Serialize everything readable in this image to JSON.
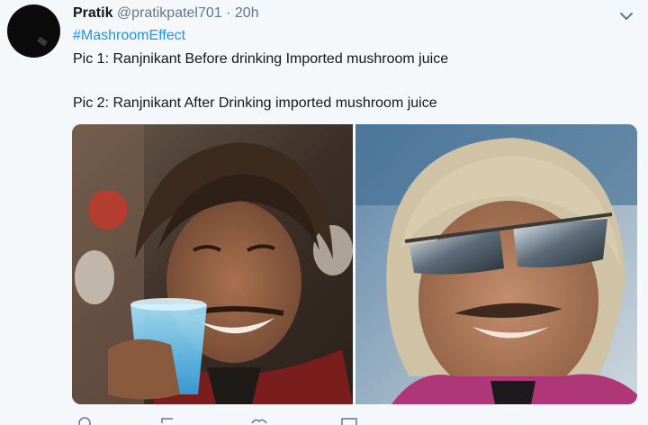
{
  "tweet": {
    "author_name": "Pratik",
    "author_handle": "@pratikpatel701",
    "separator": " · ",
    "time": "20h",
    "hashtag": "#MashroomEffect",
    "line1": "Pic 1: Ranjnikant Before drinking Imported mushroom juice",
    "line2": "Pic 2: Ranjnikant After Drinking imported mushroom juice"
  },
  "icons": {
    "caret": "chevron-down-icon",
    "actions": [
      "reply-icon",
      "retweet-icon",
      "like-icon",
      "message-icon"
    ]
  },
  "colors": {
    "background": "#f5f8fa",
    "link": "#1b95e0",
    "secondary_text": "#657786"
  }
}
